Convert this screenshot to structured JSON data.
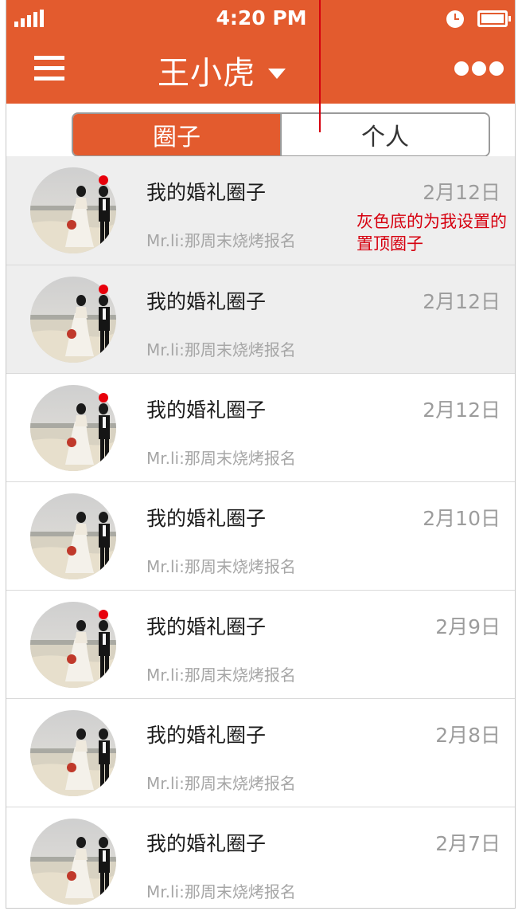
{
  "status_bar": {
    "time": "4:20 PM",
    "signal_icon": "signal-bars-icon",
    "clock_icon": "alarm-clock-icon",
    "battery_icon": "battery-icon"
  },
  "header": {
    "title": "王小虎",
    "menu_icon": "hamburger-menu-icon",
    "dropdown_icon": "caret-down-icon",
    "more_icon": "more-dots-icon",
    "background_color": "#e35b2e"
  },
  "tabs": [
    {
      "label": "圈子",
      "active": true
    },
    {
      "label": "个人",
      "active": false
    }
  ],
  "rows": [
    {
      "name": "我的婚礼圈子",
      "date": "2月12日",
      "preview": "Mr.li:那周末烧烤报名",
      "unread": true,
      "pinned": true
    },
    {
      "name": "我的婚礼圈子",
      "date": "2月12日",
      "preview": "Mr.li:那周末烧烤报名",
      "unread": true,
      "pinned": true
    },
    {
      "name": "我的婚礼圈子",
      "date": "2月12日",
      "preview": "Mr.li:那周末烧烤报名",
      "unread": true,
      "pinned": false
    },
    {
      "name": "我的婚礼圈子",
      "date": "2月10日",
      "preview": "Mr.li:那周末烧烤报名",
      "unread": false,
      "pinned": false
    },
    {
      "name": "我的婚礼圈子",
      "date": "2月9日",
      "preview": "Mr.li:那周末烧烤报名",
      "unread": true,
      "pinned": false
    },
    {
      "name": "我的婚礼圈子",
      "date": "2月8日",
      "preview": "Mr.li:那周末烧烤报名",
      "unread": false,
      "pinned": false
    },
    {
      "name": "我的婚礼圈子",
      "date": "2月7日",
      "preview": "Mr.li:那周末烧烤报名",
      "unread": false,
      "pinned": false
    }
  ],
  "annotation": {
    "text": "灰色底的为我设置的置顶圈子",
    "color": "#d6000f"
  },
  "colors": {
    "accent": "#e35b2e",
    "pinned_background": "#eeeeee",
    "unread_dot": "#e8000b"
  }
}
